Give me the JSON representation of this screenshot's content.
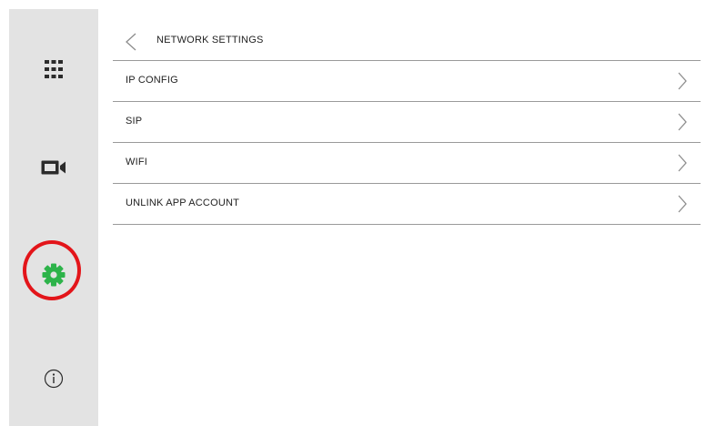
{
  "sidebar": {
    "items": [
      {
        "icon": "apps-grid-icon",
        "label": ""
      },
      {
        "icon": "video-camera-icon",
        "label": ""
      },
      {
        "icon": "gear-icon",
        "label": "",
        "active": true,
        "active_color": "#2db34a"
      },
      {
        "icon": "info-icon",
        "label": ""
      }
    ],
    "highlight_color": "#e3151a"
  },
  "header": {
    "back_icon": "chevron-left-icon",
    "title": "NETWORK SETTINGS"
  },
  "menu": {
    "items": [
      {
        "label": "IP CONFIG",
        "icon": "chevron-right-icon"
      },
      {
        "label": "SIP",
        "icon": "chevron-right-icon"
      },
      {
        "label": "WIFI",
        "icon": "chevron-right-icon"
      },
      {
        "label": "UNLINK APP ACCOUNT",
        "icon": "chevron-right-icon"
      }
    ]
  },
  "colors": {
    "sidebar_bg": "#e3e3e3",
    "divider": "#9a9a9a",
    "text": "#222222",
    "icon_dark": "#2b2b2b",
    "chevron": "#8c8c8c"
  }
}
